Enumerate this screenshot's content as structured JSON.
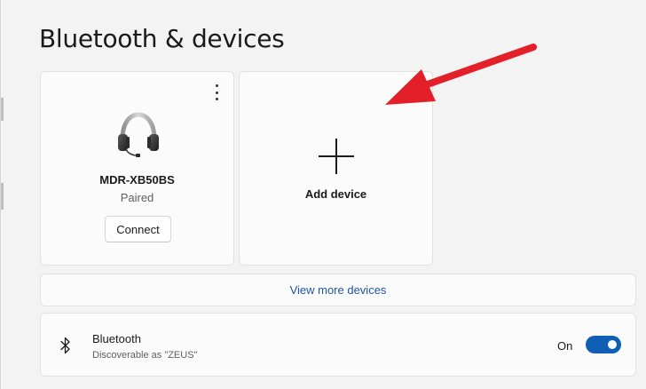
{
  "page": {
    "title": "Bluetooth & devices"
  },
  "device_card": {
    "name": "MDR-XB50BS",
    "status": "Paired",
    "connect_label": "Connect",
    "icon": "headset-icon",
    "menu_icon": "more-options-icon"
  },
  "add_card": {
    "label": "Add device",
    "icon": "plus-icon"
  },
  "view_more": {
    "label": "View more devices"
  },
  "bluetooth": {
    "title": "Bluetooth",
    "subtitle": "Discoverable as \"ZEUS\"",
    "toggle_label": "On",
    "toggle_on": true,
    "icon": "bluetooth-icon"
  },
  "colors": {
    "accent": "#0f5fb5",
    "link": "#1f55a6",
    "annotation_arrow": "#e3202a"
  }
}
